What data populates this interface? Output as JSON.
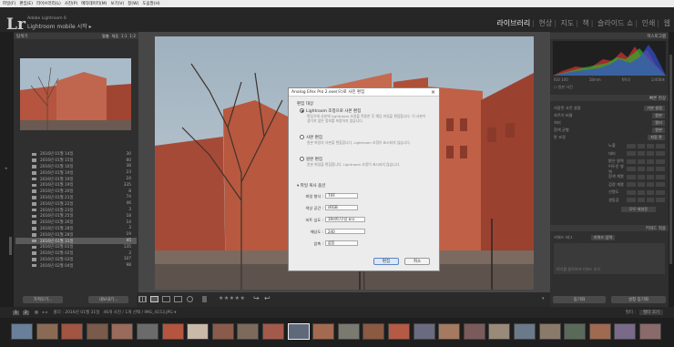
{
  "menubar": [
    "파일(F)",
    "편집(E)",
    "라이브러리(L)",
    "사진(P)",
    "메타데이터(M)",
    "보기(V)",
    "창(W)",
    "도움말(H)"
  ],
  "identity": {
    "logo": "Lr",
    "product": "Adobe Lightroom 6",
    "mobile": "Lightroom mobile 시작",
    "arrow": "▸"
  },
  "modules": [
    "라이브러리",
    "현상",
    "지도",
    "책",
    "슬라이드 쇼",
    "인쇄",
    "웹"
  ],
  "left": {
    "nav_title": "탐색기",
    "nav_zoom": [
      "맞춤",
      "채움",
      "1:1",
      "1:2"
    ],
    "folders": [
      {
        "name": "2016년 01월 14일",
        "count": "30"
      },
      {
        "name": "2016년 01월 15일",
        "count": "60"
      },
      {
        "name": "2016년 01월 16일",
        "count": "38"
      },
      {
        "name": "2016년 01월 19일",
        "count": "23"
      },
      {
        "name": "2016년 01월 19일",
        "count": "24"
      },
      {
        "name": "2016년 01월 19일",
        "count": "335"
      },
      {
        "name": "2016년 01월 20일",
        "count": "8"
      },
      {
        "name": "2016년 01월 21일",
        "count": "74"
      },
      {
        "name": "2016년 01월 22일",
        "count": "46"
      },
      {
        "name": "2016년 01월 23일",
        "count": "3"
      },
      {
        "name": "2016년 01월 25일",
        "count": "18"
      },
      {
        "name": "2016년 01월 26일",
        "count": "14"
      },
      {
        "name": "2016년 01월 28일",
        "count": "3"
      },
      {
        "name": "2016년 01월 28일",
        "count": "19"
      },
      {
        "name": "2016년 01월 31일",
        "count": "45",
        "selected": true
      },
      {
        "name": "2016년 02월 01일",
        "count": "135"
      },
      {
        "name": "2016년 02월 02일",
        "count": "3"
      },
      {
        "name": "2016년 02월 03일",
        "count": "107"
      },
      {
        "name": "2016년 02월 04일",
        "count": "98"
      }
    ],
    "import_btn": "가져오기...",
    "export_btn": "내보내기..."
  },
  "right": {
    "histogram_title": "히스토그램",
    "hist_info": [
      "ISO 100",
      "18mm",
      "f/9.0",
      "1/400초"
    ],
    "orig_photo": "원본 사진",
    "quick_develop": "빠른 현상",
    "saved_preset": "저장된 사전 설정",
    "crop_ratio": "자르기 비율",
    "treatment": "처리",
    "preset_val": "기본 설정",
    "crop_val": "원본",
    "treat_val": "컬러",
    "white_balance": "흰색 균형",
    "wb_val": "원본",
    "tone_control": "톤 조정",
    "auto_tone": "자동 톤",
    "tone_rows": [
      "노출",
      "대비",
      "밝은 영역",
      "어두운 영역",
      "흰색 계열",
      "검정 계열",
      "선명도",
      "생동감"
    ],
    "reset_all": "모두 재설정",
    "keywords": "키워드 적용",
    "keyword_tags": "키워드 태그",
    "enter_keywords": "키워드 입력",
    "keyword_hint": "여기를 클릭하여 키워드 추가",
    "sync_btn": "동기화",
    "sync_settings": "설정 동기화"
  },
  "toolbar": {
    "stars": "★★★★★"
  },
  "filmbar": {
    "page1": "1",
    "page2": "2",
    "info": "폴더 : 2016년 01월 31일",
    "count": "46개 사진 / 1개 선택 / IMG_4153.JPG ▾",
    "filter_label": "필터 :",
    "filter_val": "필터 끄기"
  },
  "dialog": {
    "title": "Analog Efex Pro 2.exe(으)로 사진 편집",
    "close": "×",
    "section1": "편집 대상",
    "opt1": "Lightroom 조정으로 사본 편집",
    "opt1_desc": "편집기에 사본에 Lightroom 조정을 적용한 후 해당 파일을 편집합니다. 이 사본이 생기지 않은 정보를 포함하지 않습니다.",
    "opt2": "사본 편집",
    "opt2_desc": "원본 파일의 사본을 편집합니다. Lightroom 조정이 표시되지 않습니다.",
    "opt3": "원본 편집",
    "opt3_desc": "원본 파일을 편집합니다. Lightroom 조정이 표시되지 않습니다.",
    "section2": "파일 복사 옵션",
    "fmt_label": "파일 형식 :",
    "fmt_val": "TIFF",
    "cs_label": "색상 공간 :",
    "cs_val": "sRGB",
    "bd_label": "비트 심도 :",
    "bd_val": "16비트/구성 요소",
    "res_label": "해상도 :",
    "res_val": "240",
    "comp_label": "압축 :",
    "comp_val": "없음",
    "edit_btn": "편집",
    "cancel_btn": "취소"
  },
  "colors": {
    "brick": "#b1533f",
    "sky": "#a8b9c6",
    "bg": "#1e1e1e"
  }
}
